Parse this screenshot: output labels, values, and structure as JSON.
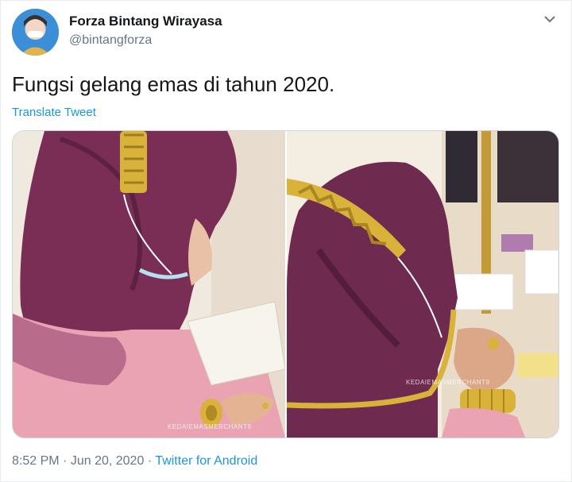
{
  "user": {
    "name": "Forza Bintang Wirayasa",
    "handle": "@bintangforza"
  },
  "tweet": {
    "text": "Fungsi gelang emas di tahun 2020.",
    "translate_label": "Translate Tweet"
  },
  "meta": {
    "time": "8:52 PM",
    "separator": "·",
    "date": "Jun 20, 2020",
    "source": "Twitter for Android"
  },
  "media": {
    "photo1_watermark": "KEDAIEMASMERCHANT9",
    "photo2_watermark": "KEDAIEMASMERCHANT9"
  },
  "colors": {
    "link": "#1b95e0",
    "muted": "#657786",
    "hijab": "#7a2e55",
    "gold": "#d9b23a",
    "pink_dress": "#e9a3b3"
  }
}
